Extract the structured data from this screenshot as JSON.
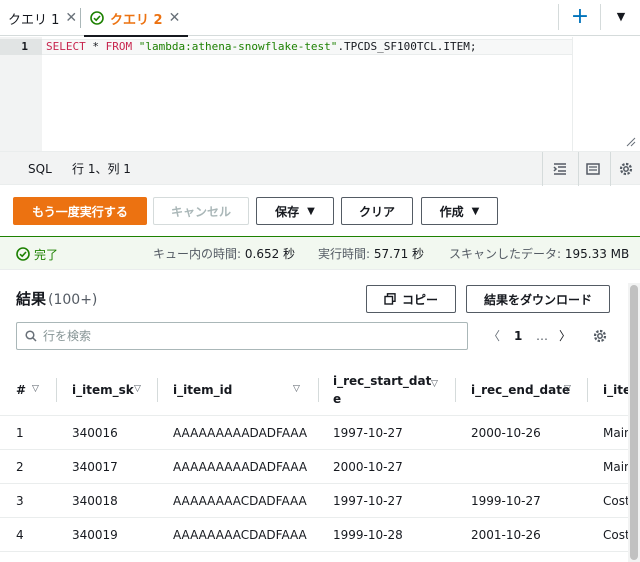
{
  "tabs": [
    {
      "label": "クエリ 1",
      "active": false
    },
    {
      "label": "クエリ 2",
      "active": true
    }
  ],
  "tabbar": {
    "new_tab": "+",
    "menu": "▼"
  },
  "editor": {
    "line_number": "1",
    "code": {
      "kw1": "SELECT",
      "op": " * ",
      "kw2": "FROM",
      "sp": " ",
      "str": "\"lambda:athena-snowflake-test\"",
      "rest": ".TPCDS_SF100TCL.ITEM;"
    }
  },
  "statusbar": {
    "language": "SQL",
    "position": "行 1、列 1"
  },
  "actions": {
    "run_again": "もう一度実行する",
    "cancel": "キャンセル",
    "save": "保存",
    "clear": "クリア",
    "create": "作成"
  },
  "query_status": {
    "state": "完了",
    "queue_time_label": "キュー内の時間:",
    "queue_time_value": "0.652 秒",
    "run_time_label": "実行時間:",
    "run_time_value": "57.71 秒",
    "scanned_label": "スキャンしたデータ:",
    "scanned_value": "195.33 MB"
  },
  "results": {
    "title": "結果",
    "count": "(100+)",
    "copy": "コピー",
    "download": "結果をダウンロード",
    "search_placeholder": "行を検索",
    "page": "1",
    "ellipsis": "…",
    "prev": "〈",
    "next": "〉"
  },
  "table": {
    "columns": [
      "#",
      "i_item_sk",
      "i_item_id",
      "i_rec_start_dat",
      "e",
      "i_rec_end_date",
      "i_ite"
    ],
    "rows": [
      [
        "1",
        "340016",
        "AAAAAAAAADADFAAA",
        "1997-10-27",
        "2000-10-26",
        "Main"
      ],
      [
        "2",
        "340017",
        "AAAAAAAAADADFAAA",
        "2000-10-27",
        "",
        "Main"
      ],
      [
        "3",
        "340018",
        "AAAAAAAACDADFAAA",
        "1997-10-27",
        "1999-10-27",
        "Cost"
      ],
      [
        "4",
        "340019",
        "AAAAAAAACDADFAAA",
        "1999-10-28",
        "2001-10-26",
        "Cost"
      ]
    ]
  },
  "colors": {
    "accent": "#ec7211",
    "link": "#0073bb",
    "success": "#1d8102"
  }
}
